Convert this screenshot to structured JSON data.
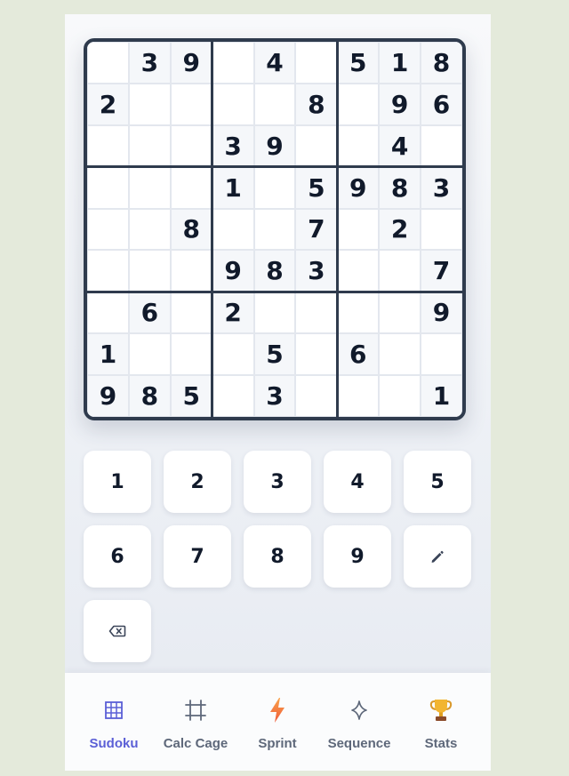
{
  "board": {
    "grid": [
      [
        "",
        "3",
        "9",
        "",
        "4",
        "",
        "5",
        "1",
        "8"
      ],
      [
        "2",
        "",
        "",
        "",
        "",
        "8",
        "",
        "9",
        "6"
      ],
      [
        "",
        "",
        "",
        "3",
        "9",
        "",
        "",
        "4",
        ""
      ],
      [
        "",
        "",
        "",
        "1",
        "",
        "5",
        "9",
        "8",
        "3"
      ],
      [
        "",
        "",
        "8",
        "",
        "",
        "7",
        "",
        "2",
        ""
      ],
      [
        "",
        "",
        "",
        "9",
        "8",
        "3",
        "",
        "",
        "7"
      ],
      [
        "",
        "6",
        "",
        "2",
        "",
        "",
        "",
        "",
        "9"
      ],
      [
        "1",
        "",
        "",
        "",
        "5",
        "",
        "6",
        "",
        ""
      ],
      [
        "9",
        "8",
        "5",
        "",
        "3",
        "",
        "",
        "",
        "1"
      ]
    ]
  },
  "keypad": {
    "digits": [
      "1",
      "2",
      "3",
      "4",
      "5",
      "6",
      "7",
      "8",
      "9"
    ],
    "pencil_icon": "pencil-icon",
    "erase_icon": "backspace-icon"
  },
  "nav": {
    "items": [
      {
        "label": "Sudoku",
        "icon": "grid-icon",
        "active": true,
        "color": "#5b5fd6"
      },
      {
        "label": "Calc Cage",
        "icon": "cage-frame-icon",
        "active": false,
        "color": "#5e687a"
      },
      {
        "label": "Sprint",
        "icon": "lightning-icon",
        "active": false,
        "color": "#f2763a"
      },
      {
        "label": "Sequence",
        "icon": "sparkle-icon",
        "active": false,
        "color": "#5e687a"
      },
      {
        "label": "Stats",
        "icon": "trophy-icon",
        "active": false,
        "color": "#e0a020"
      }
    ]
  },
  "colors": {
    "accent": "#5b5fd6",
    "board_border": "#2f3b4d",
    "digit": "#111a2b"
  }
}
